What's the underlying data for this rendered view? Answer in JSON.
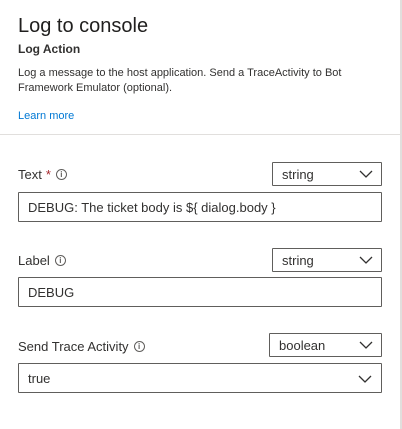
{
  "header": {
    "title": "Log to console",
    "subtitle": "Log Action",
    "description": "Log a message to the host application. Send a TraceActivity to Bot Framework Emulator (optional).",
    "learn_more": "Learn more"
  },
  "fields": [
    {
      "label": "Text",
      "required_mark": "*",
      "type": "string",
      "value": "DEBUG: The ticket body is ${ dialog.body }"
    },
    {
      "label": "Label",
      "type": "string",
      "value": "DEBUG"
    },
    {
      "label": "Send Trace Activity",
      "type": "boolean",
      "value": "true"
    }
  ],
  "colors": {
    "link": "#0078d4",
    "required": "#a4262c",
    "border": "#605e5c"
  },
  "icons": {
    "info": "info-icon",
    "dropdown": "chevron-down-icon"
  }
}
